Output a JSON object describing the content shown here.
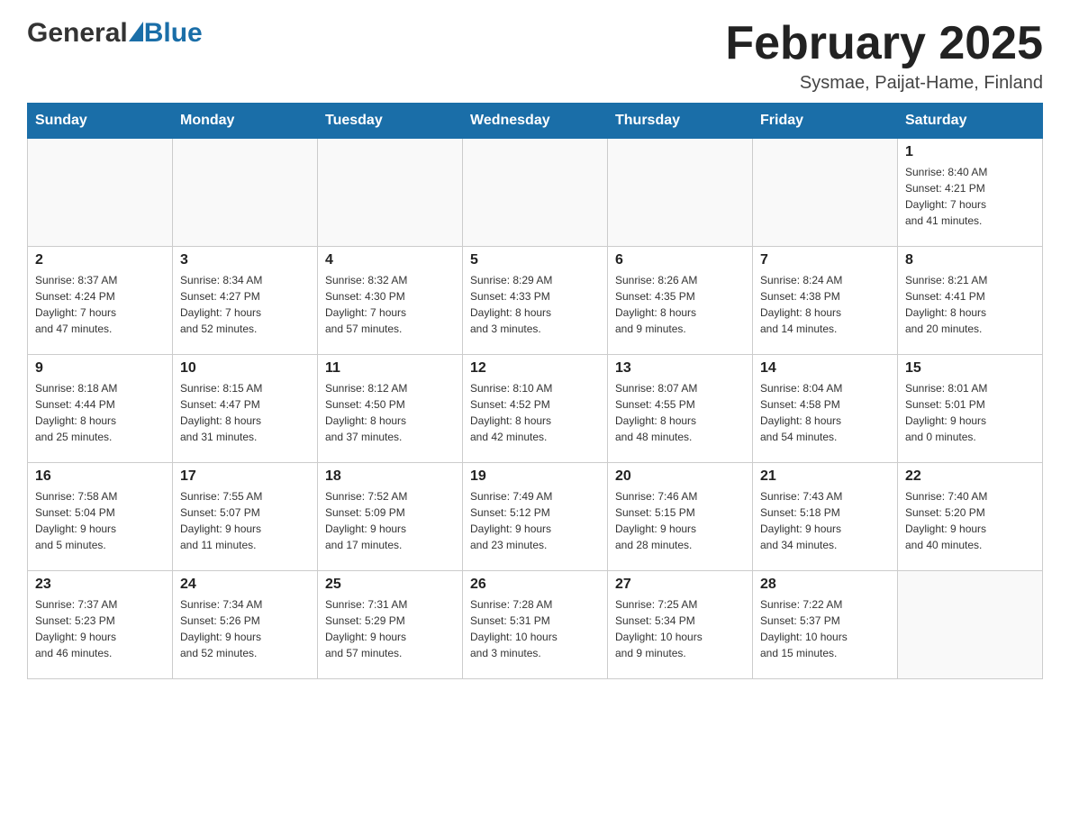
{
  "logo": {
    "general": "General",
    "triangle": "▶",
    "blue": "Blue"
  },
  "title": {
    "month": "February 2025",
    "location": "Sysmae, Paijat-Hame, Finland"
  },
  "weekdays": [
    "Sunday",
    "Monday",
    "Tuesday",
    "Wednesday",
    "Thursday",
    "Friday",
    "Saturday"
  ],
  "weeks": [
    [
      {
        "day": "",
        "info": ""
      },
      {
        "day": "",
        "info": ""
      },
      {
        "day": "",
        "info": ""
      },
      {
        "day": "",
        "info": ""
      },
      {
        "day": "",
        "info": ""
      },
      {
        "day": "",
        "info": ""
      },
      {
        "day": "1",
        "info": "Sunrise: 8:40 AM\nSunset: 4:21 PM\nDaylight: 7 hours\nand 41 minutes."
      }
    ],
    [
      {
        "day": "2",
        "info": "Sunrise: 8:37 AM\nSunset: 4:24 PM\nDaylight: 7 hours\nand 47 minutes."
      },
      {
        "day": "3",
        "info": "Sunrise: 8:34 AM\nSunset: 4:27 PM\nDaylight: 7 hours\nand 52 minutes."
      },
      {
        "day": "4",
        "info": "Sunrise: 8:32 AM\nSunset: 4:30 PM\nDaylight: 7 hours\nand 57 minutes."
      },
      {
        "day": "5",
        "info": "Sunrise: 8:29 AM\nSunset: 4:33 PM\nDaylight: 8 hours\nand 3 minutes."
      },
      {
        "day": "6",
        "info": "Sunrise: 8:26 AM\nSunset: 4:35 PM\nDaylight: 8 hours\nand 9 minutes."
      },
      {
        "day": "7",
        "info": "Sunrise: 8:24 AM\nSunset: 4:38 PM\nDaylight: 8 hours\nand 14 minutes."
      },
      {
        "day": "8",
        "info": "Sunrise: 8:21 AM\nSunset: 4:41 PM\nDaylight: 8 hours\nand 20 minutes."
      }
    ],
    [
      {
        "day": "9",
        "info": "Sunrise: 8:18 AM\nSunset: 4:44 PM\nDaylight: 8 hours\nand 25 minutes."
      },
      {
        "day": "10",
        "info": "Sunrise: 8:15 AM\nSunset: 4:47 PM\nDaylight: 8 hours\nand 31 minutes."
      },
      {
        "day": "11",
        "info": "Sunrise: 8:12 AM\nSunset: 4:50 PM\nDaylight: 8 hours\nand 37 minutes."
      },
      {
        "day": "12",
        "info": "Sunrise: 8:10 AM\nSunset: 4:52 PM\nDaylight: 8 hours\nand 42 minutes."
      },
      {
        "day": "13",
        "info": "Sunrise: 8:07 AM\nSunset: 4:55 PM\nDaylight: 8 hours\nand 48 minutes."
      },
      {
        "day": "14",
        "info": "Sunrise: 8:04 AM\nSunset: 4:58 PM\nDaylight: 8 hours\nand 54 minutes."
      },
      {
        "day": "15",
        "info": "Sunrise: 8:01 AM\nSunset: 5:01 PM\nDaylight: 9 hours\nand 0 minutes."
      }
    ],
    [
      {
        "day": "16",
        "info": "Sunrise: 7:58 AM\nSunset: 5:04 PM\nDaylight: 9 hours\nand 5 minutes."
      },
      {
        "day": "17",
        "info": "Sunrise: 7:55 AM\nSunset: 5:07 PM\nDaylight: 9 hours\nand 11 minutes."
      },
      {
        "day": "18",
        "info": "Sunrise: 7:52 AM\nSunset: 5:09 PM\nDaylight: 9 hours\nand 17 minutes."
      },
      {
        "day": "19",
        "info": "Sunrise: 7:49 AM\nSunset: 5:12 PM\nDaylight: 9 hours\nand 23 minutes."
      },
      {
        "day": "20",
        "info": "Sunrise: 7:46 AM\nSunset: 5:15 PM\nDaylight: 9 hours\nand 28 minutes."
      },
      {
        "day": "21",
        "info": "Sunrise: 7:43 AM\nSunset: 5:18 PM\nDaylight: 9 hours\nand 34 minutes."
      },
      {
        "day": "22",
        "info": "Sunrise: 7:40 AM\nSunset: 5:20 PM\nDaylight: 9 hours\nand 40 minutes."
      }
    ],
    [
      {
        "day": "23",
        "info": "Sunrise: 7:37 AM\nSunset: 5:23 PM\nDaylight: 9 hours\nand 46 minutes."
      },
      {
        "day": "24",
        "info": "Sunrise: 7:34 AM\nSunset: 5:26 PM\nDaylight: 9 hours\nand 52 minutes."
      },
      {
        "day": "25",
        "info": "Sunrise: 7:31 AM\nSunset: 5:29 PM\nDaylight: 9 hours\nand 57 minutes."
      },
      {
        "day": "26",
        "info": "Sunrise: 7:28 AM\nSunset: 5:31 PM\nDaylight: 10 hours\nand 3 minutes."
      },
      {
        "day": "27",
        "info": "Sunrise: 7:25 AM\nSunset: 5:34 PM\nDaylight: 10 hours\nand 9 minutes."
      },
      {
        "day": "28",
        "info": "Sunrise: 7:22 AM\nSunset: 5:37 PM\nDaylight: 10 hours\nand 15 minutes."
      },
      {
        "day": "",
        "info": ""
      }
    ]
  ]
}
